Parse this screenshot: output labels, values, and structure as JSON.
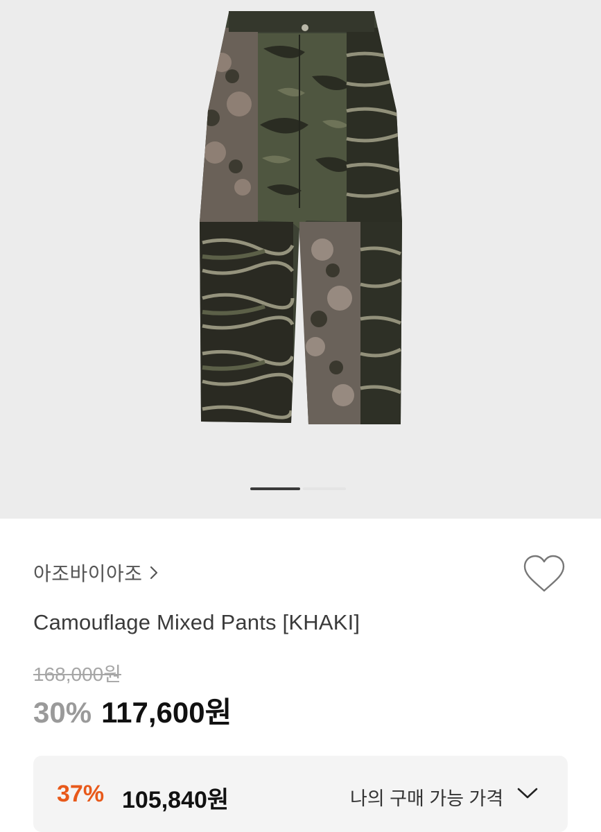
{
  "hero": {
    "image_alt": "Camouflage Mixed Pants [KHAKI]",
    "carousel": {
      "slide_count": 2,
      "active_index": 0
    }
  },
  "brand": {
    "name": "아조바이아조"
  },
  "product": {
    "name": "Camouflage Mixed Pants [KHAKI]",
    "original_price": "168,000원",
    "discount_rate": "30%",
    "sale_price": "117,600원"
  },
  "my_price": {
    "discount_rate": "37%",
    "price": "105,840원",
    "label": "나의 구매 가능 가격"
  },
  "colors": {
    "accent_orange": "#e8591a",
    "hero_background": "#ececec",
    "box_background": "#f4f4f4"
  },
  "icons": {
    "brand_link": "chevron-right-icon",
    "wishlist": "heart-icon",
    "expand": "chevron-down-icon"
  }
}
